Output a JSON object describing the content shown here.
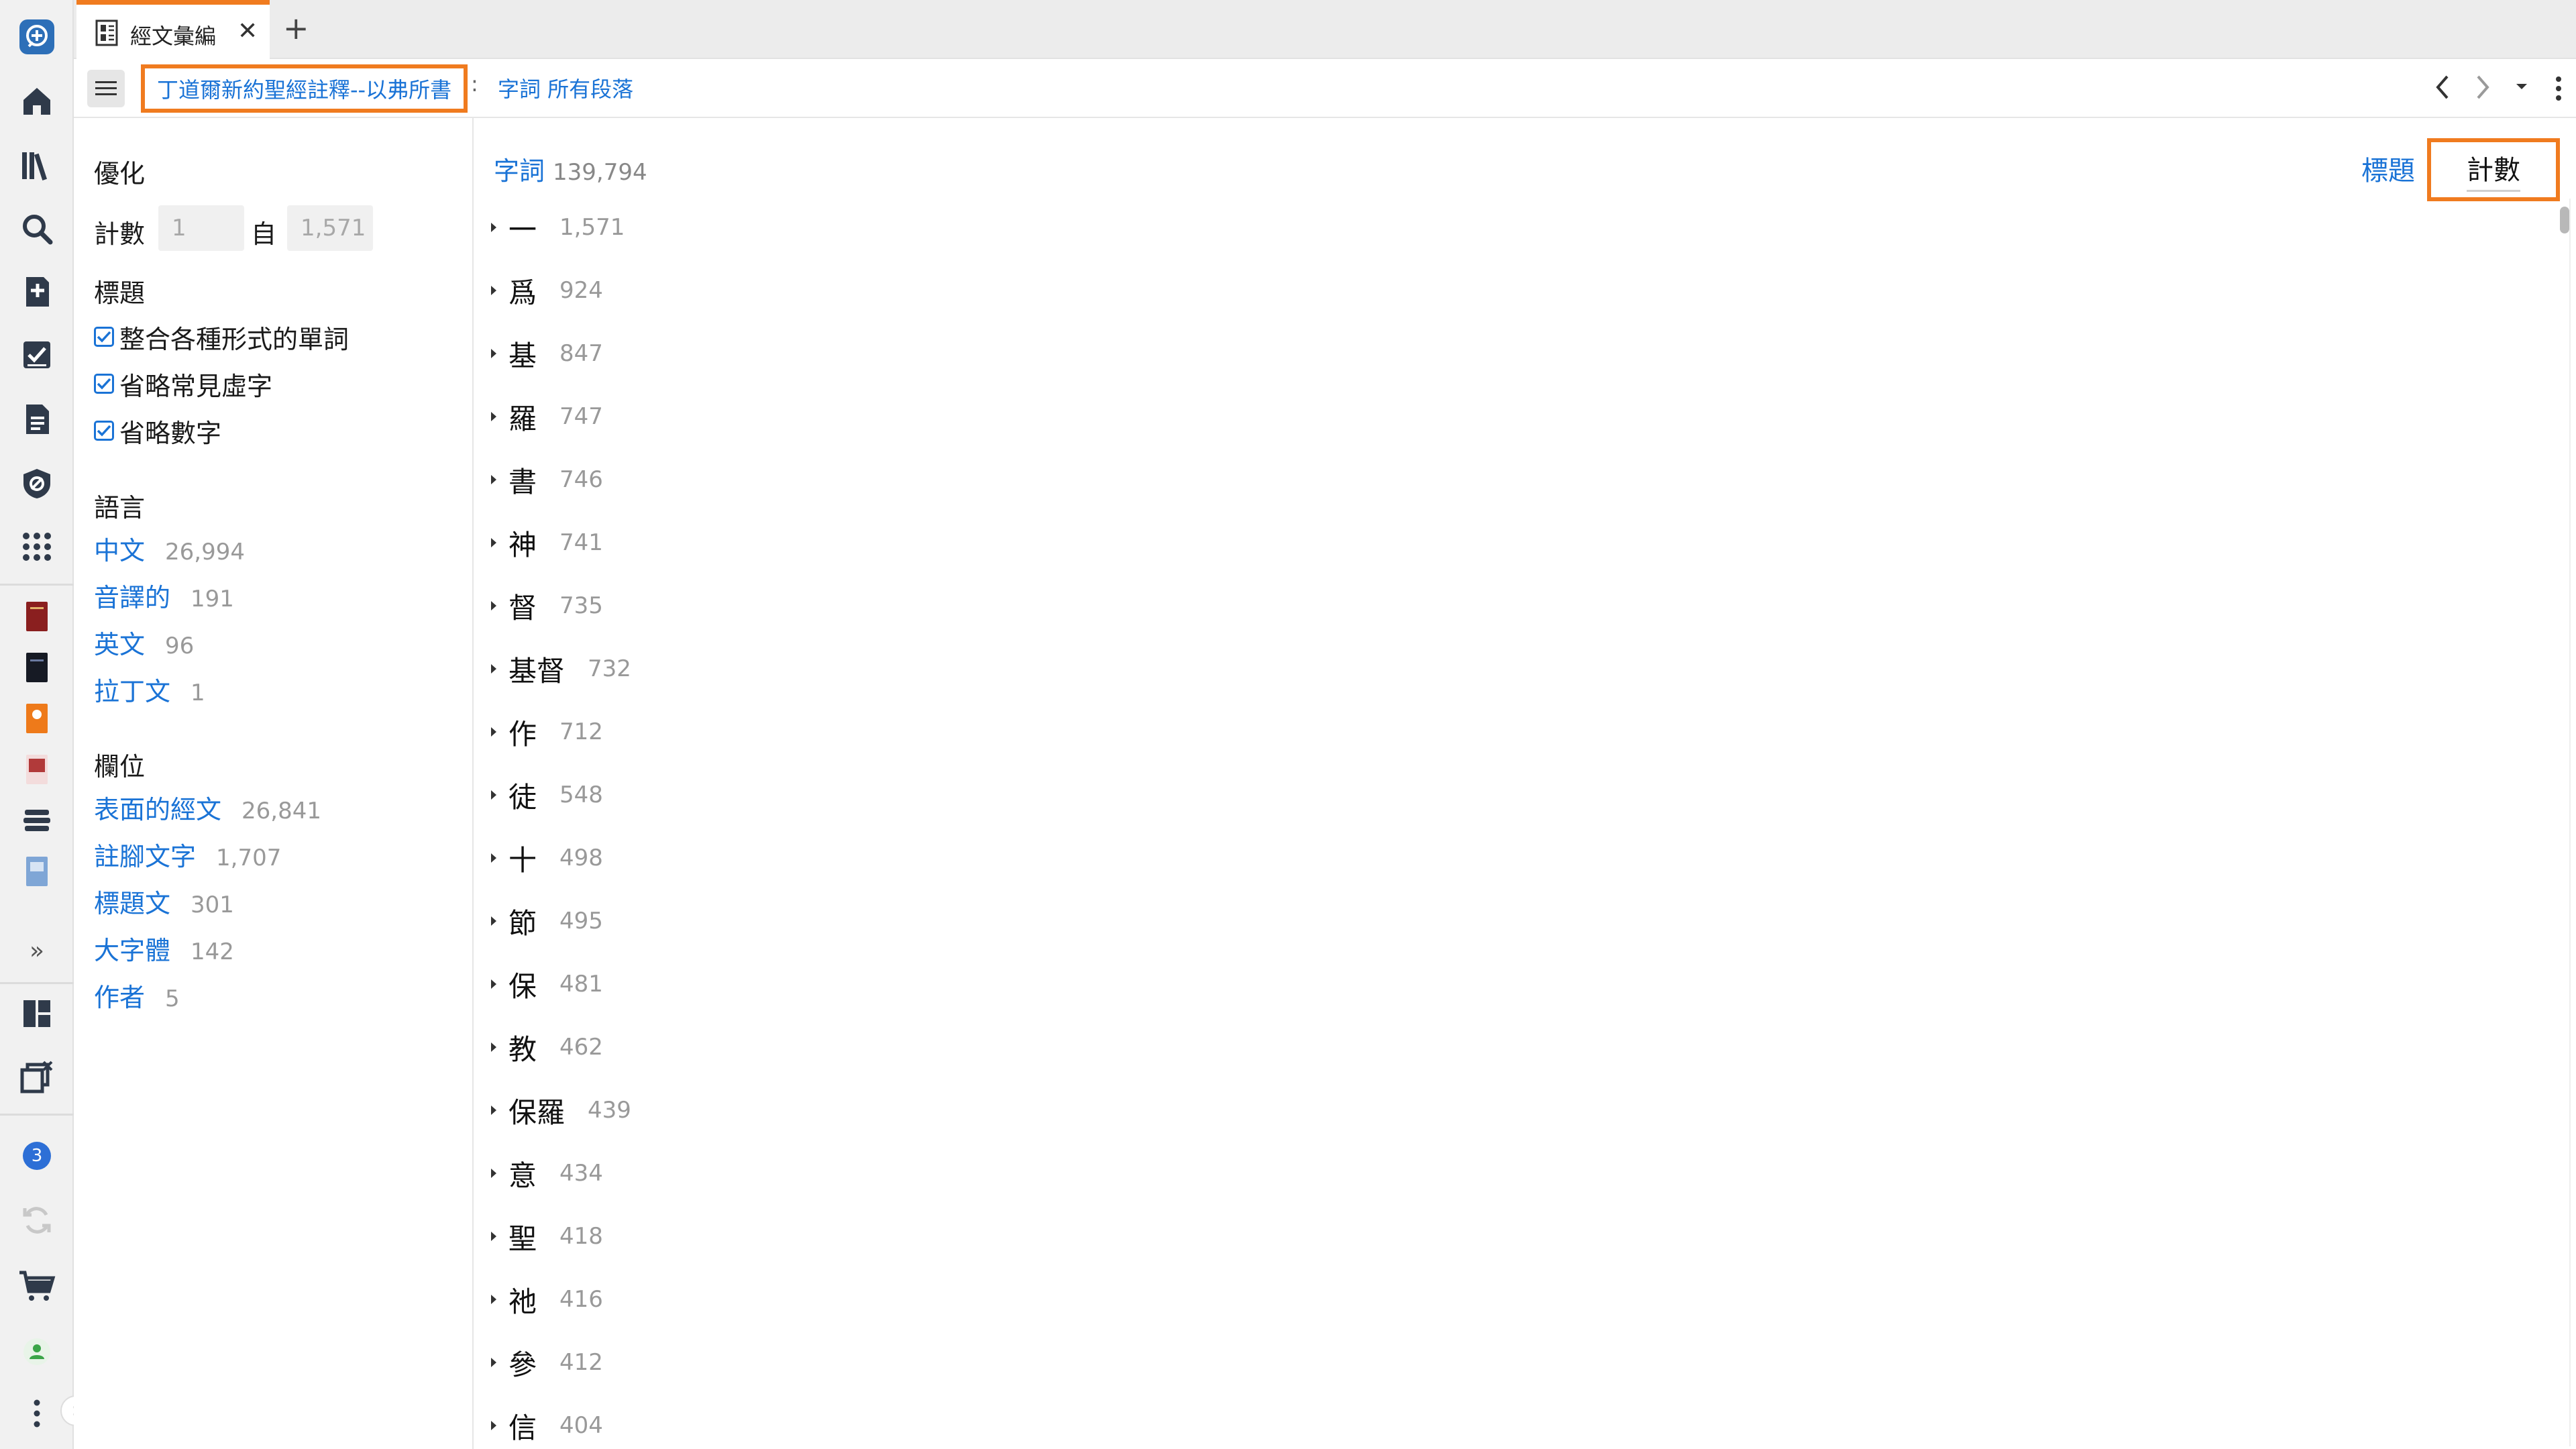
{
  "colors": {
    "accent_orange": "#f07b1f",
    "link_blue": "#1a73d6",
    "muted_gray": "#999999"
  },
  "rail": {
    "icons": [
      "logos-logo-icon",
      "home-icon",
      "library-icon",
      "search-icon",
      "add-note-icon",
      "checklist-icon",
      "document-icon",
      "shield-book-icon",
      "apps-grid-icon",
      "book-red-icon",
      "book-black-icon",
      "book-orange-icon",
      "book-pink-icon",
      "layers-icon",
      "book-blue-icon",
      "expand-icon",
      "layout-icon",
      "close-panels-icon",
      "notification-badge",
      "sync-icon",
      "cart-icon",
      "user-icon",
      "more-icon"
    ],
    "badge_count": "3",
    "expand_glyph": "»",
    "collapse_glyph": "›"
  },
  "tabbar": {
    "tab_title": "經文彙編",
    "close_glyph": "✕",
    "add_glyph": "+"
  },
  "toolbar": {
    "resource_title": "丁道爾新約聖經註釋--以弗所書",
    "separator": ":",
    "breadcrumb": "字詞 所有段落"
  },
  "refine": {
    "title": "優化",
    "count_label": "計數",
    "count_min": "1",
    "from_label": "自",
    "count_max": "1,571",
    "headings_title": "標題",
    "options": [
      {
        "label": "整合各種形式的單詞",
        "checked": true
      },
      {
        "label": "省略常見虛字",
        "checked": true
      },
      {
        "label": "省略數字",
        "checked": true
      }
    ],
    "language_title": "語言",
    "languages": [
      {
        "name": "中文",
        "count": "26,994"
      },
      {
        "name": "音譯的",
        "count": "191"
      },
      {
        "name": "英文",
        "count": "96"
      },
      {
        "name": "拉丁文",
        "count": "1"
      }
    ],
    "fields_title": "欄位",
    "fields": [
      {
        "name": "表面的經文",
        "count": "26,841"
      },
      {
        "name": "註腳文字",
        "count": "1,707"
      },
      {
        "name": "標題文",
        "count": "301"
      },
      {
        "name": "大字體",
        "count": "142"
      },
      {
        "name": "作者",
        "count": "5"
      }
    ]
  },
  "main": {
    "header_label": "字詞",
    "header_total": "139,794",
    "sort_by_title": "標題",
    "sort_by_count": "計數",
    "words": [
      {
        "word": "一",
        "count": "1,571"
      },
      {
        "word": "爲",
        "count": "924"
      },
      {
        "word": "基",
        "count": "847"
      },
      {
        "word": "羅",
        "count": "747"
      },
      {
        "word": "書",
        "count": "746"
      },
      {
        "word": "神",
        "count": "741"
      },
      {
        "word": "督",
        "count": "735"
      },
      {
        "word": "基督",
        "count": "732"
      },
      {
        "word": "作",
        "count": "712"
      },
      {
        "word": "徒",
        "count": "548"
      },
      {
        "word": "十",
        "count": "498"
      },
      {
        "word": "節",
        "count": "495"
      },
      {
        "word": "保",
        "count": "481"
      },
      {
        "word": "教",
        "count": "462"
      },
      {
        "word": "保羅",
        "count": "439"
      },
      {
        "word": "意",
        "count": "434"
      },
      {
        "word": "聖",
        "count": "418"
      },
      {
        "word": "祂",
        "count": "416"
      },
      {
        "word": "參",
        "count": "412"
      },
      {
        "word": "信",
        "count": "404"
      }
    ]
  }
}
